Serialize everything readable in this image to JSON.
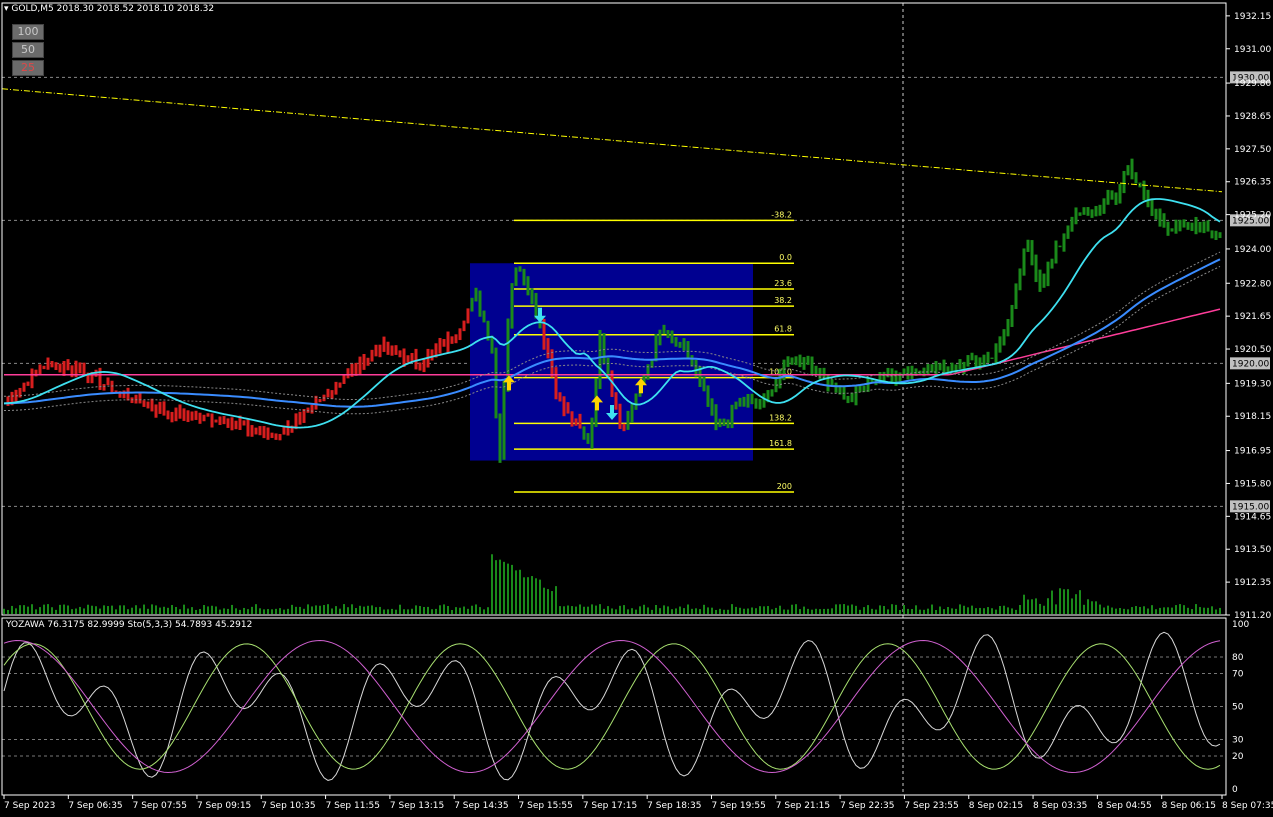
{
  "header": {
    "symbol": "GOLD,M5",
    "ohlc": "2018.30 2018.52 2018.10 2018.32"
  },
  "lot_buttons": [
    "100",
    "50",
    "25"
  ],
  "colors": {
    "bull": "#1a8a1a",
    "bear": "#d81e1e",
    "cyan_ma": "#3ee0f0",
    "magenta_ma": "#ff3d9a",
    "blue_ma": "#3a8cff",
    "fib": "#ffff00",
    "box": "#000090",
    "grid": "#ffffff"
  },
  "price_axis": {
    "ticks": [
      "1932.15",
      "1931.00",
      "1929.80",
      "1928.65",
      "1927.50",
      "1926.35",
      "1925.20",
      "1924.00",
      "1922.80",
      "1921.65",
      "1920.50",
      "1919.30",
      "1918.15",
      "1916.95",
      "1915.80",
      "1914.65",
      "1913.50",
      "1912.35",
      "1911.20"
    ],
    "highlighted": [
      "1930.00",
      "1925.00",
      "1920.00",
      "1915.00"
    ]
  },
  "time_axis": [
    "7 Sep 2023",
    "7 Sep 06:35",
    "7 Sep 07:55",
    "7 Sep 09:15",
    "7 Sep 10:35",
    "7 Sep 11:55",
    "7 Sep 13:15",
    "7 Sep 14:35",
    "7 Sep 15:55",
    "7 Sep 17:15",
    "7 Sep 18:35",
    "7 Sep 19:55",
    "7 Sep 21:15",
    "7 Sep 22:35",
    "7 Sep 23:55",
    "8 Sep 02:15",
    "8 Sep 03:35",
    "8 Sep 04:55",
    "8 Sep 06:15",
    "8 Sep 07:35"
  ],
  "indicator": {
    "label": "YOZAWA 76.3175 82.9999  Sto(5,3,3) 54.7893 45.2912",
    "levels": [
      "100",
      "80",
      "70",
      "50",
      "30",
      "20",
      "0"
    ]
  },
  "chart_data": {
    "type": "bar",
    "title": "GOLD,M5",
    "price_range": [
      1911.2,
      1932.6
    ],
    "fibonacci": [
      {
        "label": "-38.2",
        "price": 1925.0
      },
      {
        "label": "0.0",
        "price": 1923.5
      },
      {
        "label": "23.6",
        "price": 1922.6
      },
      {
        "label": "38.2",
        "price": 1922.0
      },
      {
        "label": "61.8",
        "price": 1921.0
      },
      {
        "label": "100.0",
        "price": 1919.5
      },
      {
        "label": "138.2",
        "price": 1917.9
      },
      {
        "label": "161.8",
        "price": 1917.0
      },
      {
        "label": "200",
        "price": 1915.5
      }
    ],
    "stochastic": {
      "main": 54.7893,
      "signal": 45.2912
    },
    "yozawa": [
      76.3175,
      82.9999
    ]
  }
}
